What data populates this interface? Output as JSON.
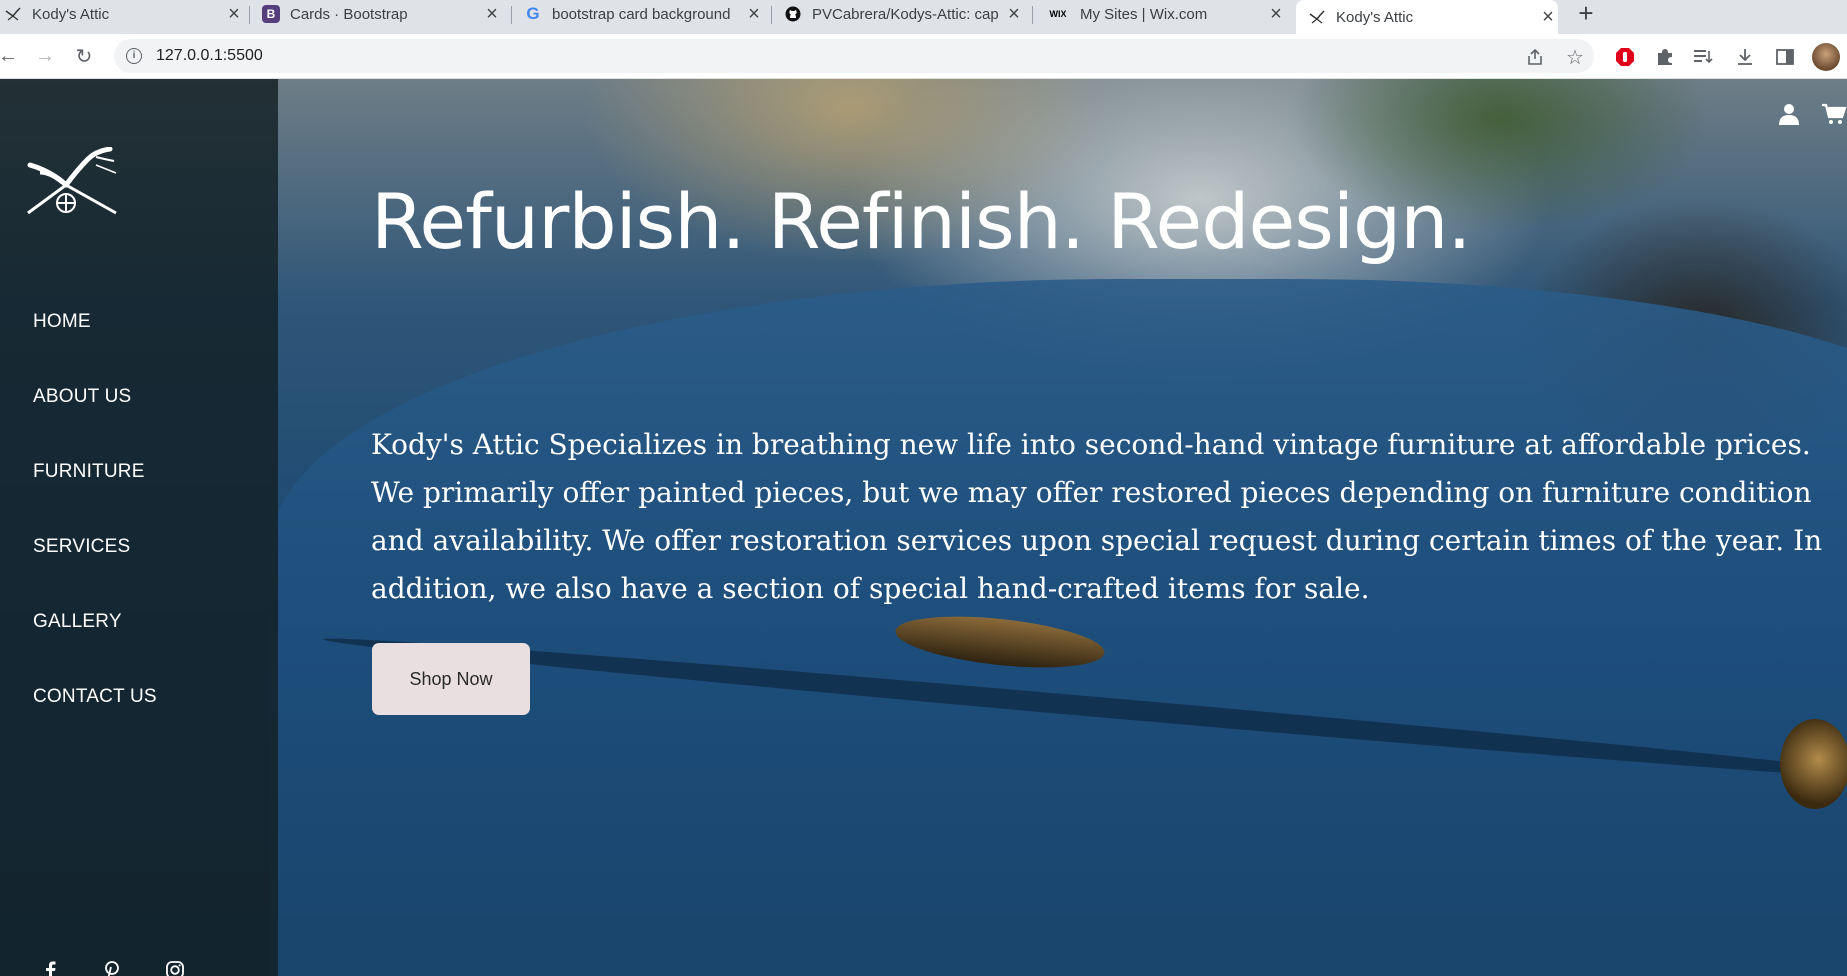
{
  "browser": {
    "tabs": [
      {
        "title": "Kody's Attic",
        "favicon": "kodys-attic-favicon",
        "active": false
      },
      {
        "title": "Cards · Bootstrap",
        "favicon": "bootstrap-favicon",
        "active": false
      },
      {
        "title": "bootstrap card background",
        "favicon": "google-favicon",
        "active": false
      },
      {
        "title": "PVCabrera/Kodys-Attic: cap",
        "favicon": "github-favicon",
        "active": false
      },
      {
        "title": "My Sites | Wix.com",
        "favicon": "wix-favicon",
        "active": false
      },
      {
        "title": "Kody's Attic",
        "favicon": "kodys-attic-favicon",
        "active": true
      }
    ],
    "favicon_text": {
      "bootstrap": "B",
      "google": "G",
      "wix": "WIX"
    },
    "url": "127.0.0.1:5500"
  },
  "sidebar": {
    "nav": [
      "HOME",
      "ABOUT US",
      "FURNITURE",
      "SERVICES",
      "GALLERY",
      "CONTACT US"
    ],
    "social_icons": [
      "facebook-icon",
      "pinterest-icon",
      "instagram-icon"
    ]
  },
  "hero": {
    "headline": "Refurbish. Refinish. Redesign.",
    "description": "Kody's Attic Specializes in breathing new life into second-hand vintage furniture at affordable prices. We primarily offer painted pieces, but we may offer restored pieces depending on furniture condition and availability. We offer restoration services upon special request during certain times of the year. In addition, we also have a section of special hand-crafted items for sale.",
    "button_label": "Shop Now"
  },
  "header_icons": [
    "user-icon",
    "cart-icon"
  ],
  "colors": {
    "sidebar_bg": "#122024",
    "button_bg": "#e9dfe0",
    "accent_blue": "#1f4a72"
  }
}
